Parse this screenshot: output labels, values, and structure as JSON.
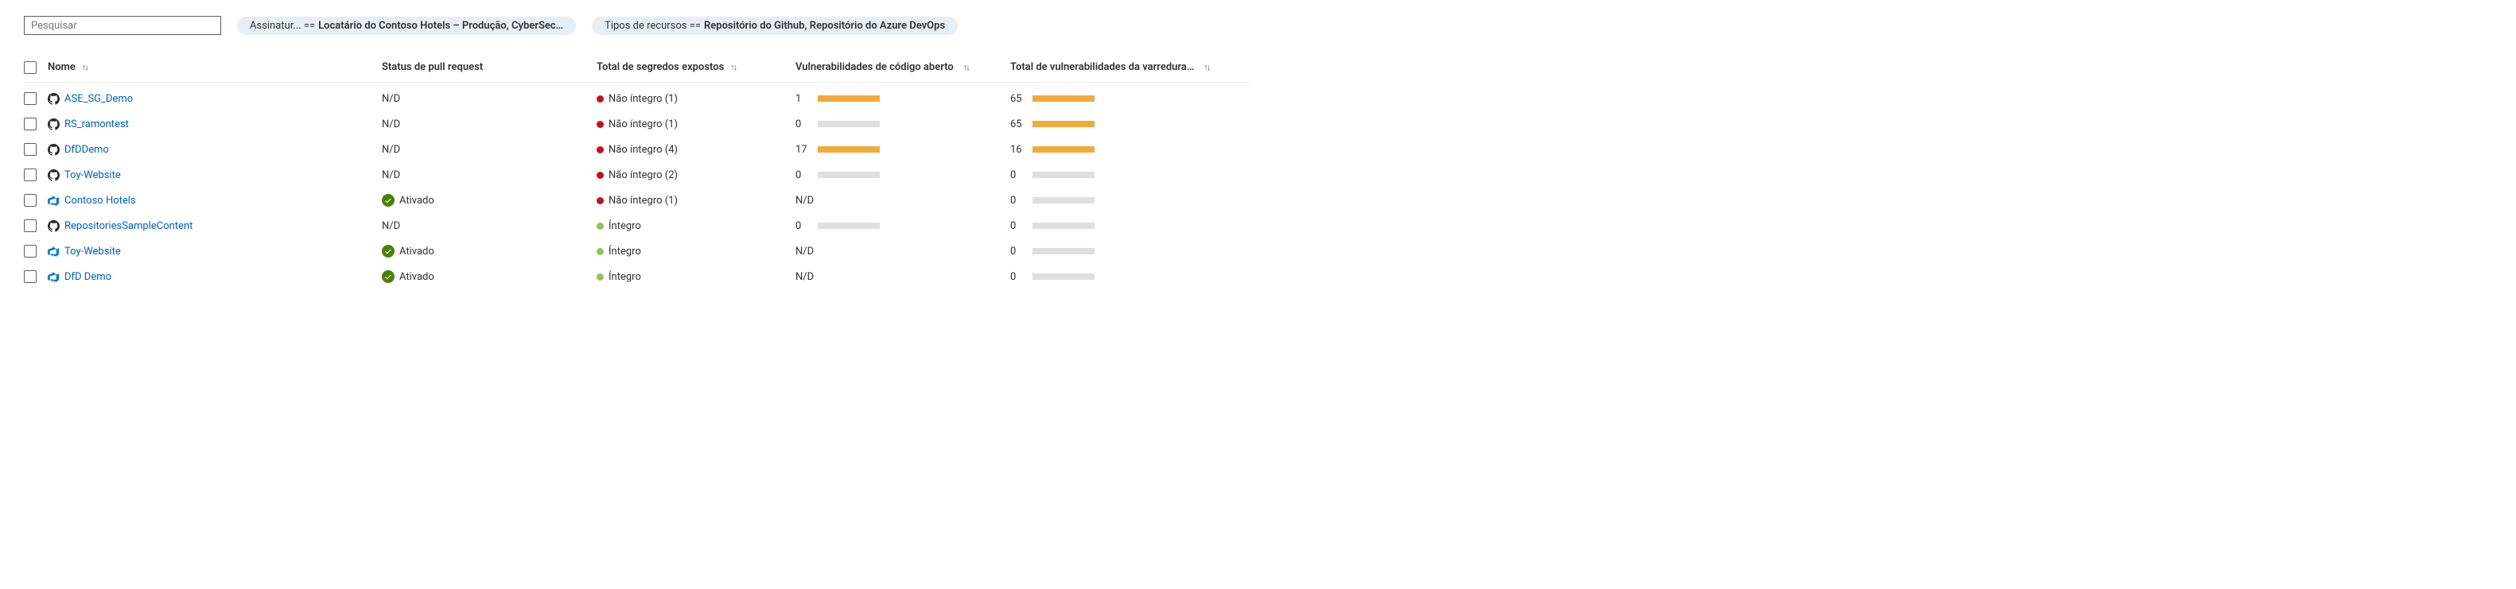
{
  "search": {
    "placeholder": "Pesquisar"
  },
  "filters": [
    {
      "label": "Assinatur... ==",
      "value": "Locatário do Contoso Hotels – Produção, CyberSec…"
    },
    {
      "label": "Tipos de recursos ==",
      "value": "Repositório do Github, Repositório do Azure DevOps"
    }
  ],
  "columns": {
    "name": "Nome",
    "pr": "Status de pull request",
    "secrets": "Total de segredos expostos",
    "oss": "Vulnerabilidades de código aberto",
    "scan": "Total de vulnerabilidades da varredura…"
  },
  "sort_glyph": "↑↓",
  "status_labels": {
    "nd": "N/D",
    "enabled": "Ativado",
    "unhealthy": "Não íntegro",
    "healthy": "Íntegro"
  },
  "rows": [
    {
      "name": "ASE_SG_Demo",
      "icon": "github",
      "pr": "nd",
      "secrets": {
        "state": "unhealthy",
        "count": 1
      },
      "oss": {
        "text": "1",
        "fills": [
          [
            "yellow",
            100
          ]
        ]
      },
      "scan": {
        "text": "65",
        "fills": [
          [
            "yellow",
            100
          ]
        ]
      }
    },
    {
      "name": "RS_ramontest",
      "icon": "github",
      "pr": "nd",
      "secrets": {
        "state": "unhealthy",
        "count": 1
      },
      "oss": {
        "text": "0",
        "fills": []
      },
      "scan": {
        "text": "65",
        "fills": [
          [
            "yellow",
            100
          ]
        ]
      }
    },
    {
      "name": "DfDDemo",
      "icon": "github",
      "pr": "nd",
      "secrets": {
        "state": "unhealthy",
        "count": 4
      },
      "oss": {
        "text": "17",
        "fills": [
          [
            "red",
            80
          ],
          [
            "yellow",
            100
          ]
        ]
      },
      "scan": {
        "text": "16",
        "fills": [
          [
            "yellow",
            100
          ]
        ]
      }
    },
    {
      "name": "Toy-Website",
      "icon": "github",
      "pr": "nd",
      "secrets": {
        "state": "unhealthy",
        "count": 2
      },
      "oss": {
        "text": "0",
        "fills": []
      },
      "scan": {
        "text": "0",
        "fills": []
      }
    },
    {
      "name": "Contoso Hotels",
      "icon": "devops",
      "pr": "enabled",
      "secrets": {
        "state": "unhealthy",
        "count": 1
      },
      "oss": {
        "text": "N/D",
        "nobar": true
      },
      "scan": {
        "text": "0",
        "fills": []
      }
    },
    {
      "name": "RepositoriesSampleContent",
      "icon": "github",
      "pr": "nd",
      "secrets": {
        "state": "healthy"
      },
      "oss": {
        "text": "0",
        "fills": []
      },
      "scan": {
        "text": "0",
        "fills": []
      }
    },
    {
      "name": "Toy-Website",
      "icon": "devops",
      "pr": "enabled",
      "secrets": {
        "state": "healthy"
      },
      "oss": {
        "text": "N/D",
        "nobar": true
      },
      "scan": {
        "text": "0",
        "fills": []
      }
    },
    {
      "name": "DfD Demo",
      "icon": "devops",
      "pr": "enabled",
      "secrets": {
        "state": "healthy"
      },
      "oss": {
        "text": "N/D",
        "nobar": true
      },
      "scan": {
        "text": "0",
        "fills": []
      }
    }
  ]
}
